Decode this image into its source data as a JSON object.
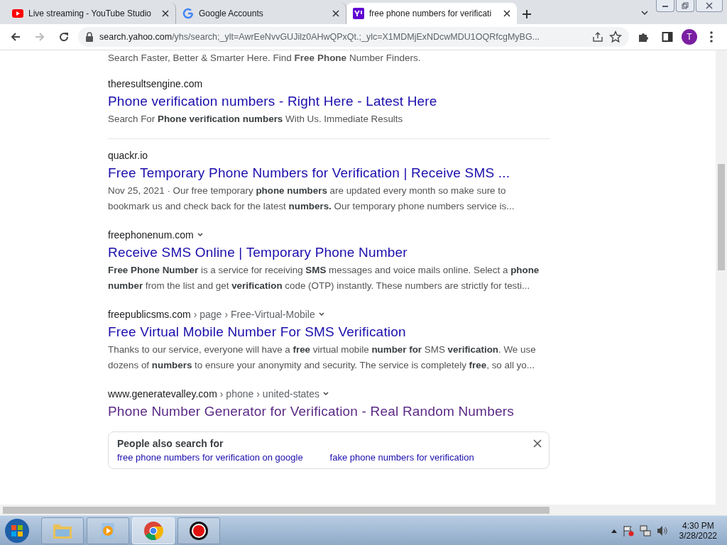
{
  "tabs": [
    {
      "title": "Live streaming - YouTube Studio",
      "selected": false
    },
    {
      "title": "Google Accounts",
      "selected": false
    },
    {
      "title": "free phone numbers for verificati",
      "selected": true
    }
  ],
  "address_bar": {
    "host": "search.yahoo.com",
    "path": "/yhs/search;_ylt=AwrEeNvvGUJilz0AHwQPxQt.;_ylc=X1MDMjExNDcwMDU1OQRfcgMyBG..."
  },
  "profile": {
    "initial": "T"
  },
  "top_snippet": "Search Faster, Better & Smarter Here. Find **Free Phone** Number Finders.",
  "results": [
    {
      "domain": "theresultsengine.com",
      "dropdown": false,
      "title": "Phone verification numbers - Right Here - Latest Here",
      "visited": false,
      "snippet": "Search For **Phone verification numbers** With Us. Immediate Results",
      "divider": true
    },
    {
      "domain": "quackr.io",
      "dropdown": false,
      "title": "Free Temporary Phone Numbers for Verification | Receive SMS ...",
      "visited": false,
      "date": "Nov 25, 2021 · ",
      "snippet": "Our free temporary **phone numbers** are updated every month so make sure to bookmark us and check back for the latest **numbers.** Our temporary phone numbers service is...",
      "divider": false
    },
    {
      "domain": "freephonenum.com",
      "dropdown": true,
      "title": "Receive SMS Online | Temporary Phone Number",
      "visited": false,
      "snippet": "**Free Phone Number** is a service for receiving **SMS** messages and voice mails online. Select a **phone number** from the list and get **verification** code (OTP) instantly. These numbers are strictly for testi...",
      "divider": false
    },
    {
      "domain": "freepublicsms.com",
      "path": [
        "› page",
        "› Free-Virtual-Mobile"
      ],
      "dropdown": true,
      "title": "Free Virtual Mobile Number For SMS Verification",
      "visited": false,
      "snippet": "Thanks to our service, everyone will have a **free** virtual mobile **number for** SMS **verification**. We use dozens of **numbers** to ensure your anonymity and security. The service is completely **free**, so all yo...",
      "divider": false
    },
    {
      "domain": "www.generatevalley.com",
      "path": [
        "› phone",
        "› united-states"
      ],
      "dropdown": true,
      "title": "Phone Number Generator for Verification - Real Random Numbers",
      "visited": true,
      "divider": false
    }
  ],
  "people_also_search": {
    "heading": "People also search for",
    "links": [
      "free phone numbers for verification on google",
      "fake phone numbers for verification"
    ]
  },
  "taskbar": {
    "apps": [
      {
        "kind": "explorer",
        "selected": false
      },
      {
        "kind": "media",
        "selected": false
      },
      {
        "kind": "chrome",
        "selected": true
      },
      {
        "kind": "recorder",
        "selected": false
      }
    ]
  },
  "clock": {
    "time": "4:30 PM",
    "date": "3/28/2022"
  }
}
